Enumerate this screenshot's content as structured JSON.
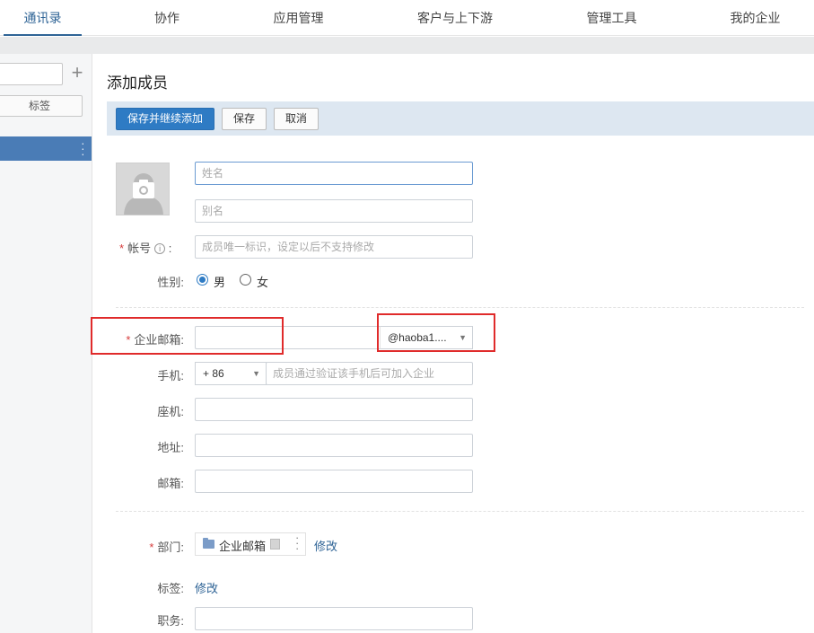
{
  "nav": {
    "tabs": [
      "通讯录",
      "协作",
      "应用管理",
      "客户与上下游",
      "管理工具",
      "我的企业"
    ]
  },
  "sidebar": {
    "plus": "+",
    "tag_button": "标签"
  },
  "page": {
    "title": "添加成员"
  },
  "toolbar": {
    "save_continue": "保存并继续添加",
    "save": "保存",
    "cancel": "取消"
  },
  "form": {
    "name_placeholder": "姓名",
    "alias_placeholder": "别名",
    "account_label": "帐号",
    "account_placeholder": "成员唯一标识，设定以后不支持修改",
    "gender_label": "性别:",
    "gender_male": "男",
    "gender_female": "女",
    "corp_email_label": "企业邮箱:",
    "corp_email_domain": "@haoba1....",
    "mobile_label": "手机:",
    "mobile_code": "+ 86",
    "mobile_placeholder": "成员通过验证该手机后可加入企业",
    "landline_label": "座机:",
    "address_label": "地址:",
    "email_label": "邮箱:",
    "dept_label": "部门:",
    "dept_value": "企业邮箱",
    "dept_edit": "修改",
    "tag_label": "标签:",
    "tag_edit": "修改",
    "position_label": "职务:"
  },
  "colors": {
    "primary": "#2e7bc4",
    "link": "#2f6496",
    "required": "#d63b3b",
    "highlight_box": "#e02b2b"
  }
}
